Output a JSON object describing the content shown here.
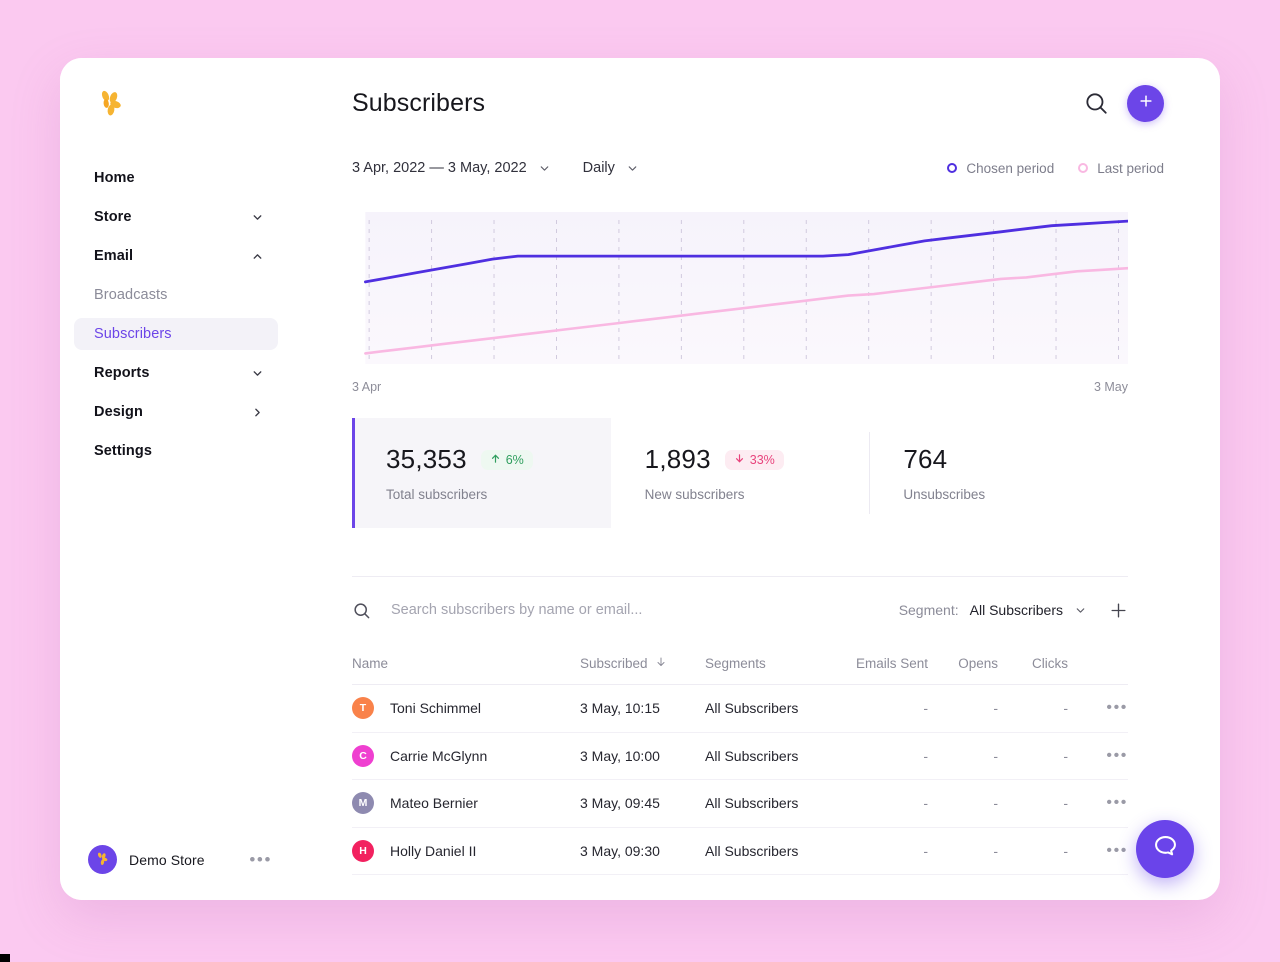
{
  "window": {
    "title": "Subscribers"
  },
  "brand": {
    "logo_icon": "butterfly-logo-icon",
    "accent": "#6c45e8",
    "logo_color": "#f6b432"
  },
  "sidebar": {
    "items": [
      {
        "label": "Home",
        "icon": "",
        "state": "default"
      },
      {
        "label": "Store",
        "icon": "chevron-down-icon",
        "state": "default"
      },
      {
        "label": "Email",
        "icon": "chevron-up-icon",
        "state": "default"
      },
      {
        "label": "Broadcasts",
        "icon": "",
        "state": "sub"
      },
      {
        "label": "Subscribers",
        "icon": "",
        "state": "active"
      },
      {
        "label": "Reports",
        "icon": "chevron-down-icon",
        "state": "default"
      },
      {
        "label": "Design",
        "icon": "chevron-right-icon",
        "state": "default"
      },
      {
        "label": "Settings",
        "icon": "",
        "state": "default"
      }
    ],
    "footer": {
      "store_name": "Demo Store",
      "avatar_icon": "butterfly-logo-icon",
      "menu_icon": "more-horizontal-icon"
    }
  },
  "topbar": {
    "title": "Subscribers",
    "search_icon": "search-icon",
    "add_icon": "plus-icon"
  },
  "filters": {
    "date_range": "3 Apr, 2022 — 3 May, 2022",
    "date_chevron": "chevron-down-icon",
    "granularity": "Daily",
    "granularity_chevron": "chevron-down-icon",
    "legend": [
      {
        "label": "Chosen period",
        "color": "#4f2fe0"
      },
      {
        "label": "Last period",
        "color": "#f9b8e2"
      }
    ]
  },
  "chart_data": {
    "type": "line",
    "title": "",
    "xlabel": "",
    "ylabel": "",
    "grid": "vertical-dashed",
    "legend_position": "top-right",
    "x_axis_start_label": "3 Apr",
    "x_axis_end_label": "3 May",
    "x": [
      0,
      1,
      2,
      3,
      4,
      5,
      6,
      7,
      8,
      9,
      10,
      11,
      12,
      13,
      14,
      15,
      16,
      17,
      18,
      19,
      20,
      21,
      22,
      23,
      24,
      25,
      26,
      27,
      28,
      29,
      30
    ],
    "ylim": [
      0,
      100
    ],
    "series": [
      {
        "name": "Chosen period",
        "color": "#4f2fe0",
        "values": [
          54,
          57,
          60,
          63,
          66,
          69,
          71,
          71,
          71,
          71,
          71,
          71,
          71,
          71,
          71,
          71,
          71,
          71,
          71,
          72,
          75,
          78,
          81,
          83,
          85,
          87,
          89,
          91,
          92,
          93,
          94
        ]
      },
      {
        "name": "Last period",
        "color": "#f9b8e2",
        "values": [
          7,
          9,
          11,
          13,
          15,
          17,
          19,
          21,
          23,
          25,
          27,
          29,
          31,
          33,
          35,
          37,
          39,
          41,
          43,
          45,
          46,
          48,
          50,
          52,
          54,
          56,
          57,
          59,
          61,
          62,
          63
        ]
      }
    ]
  },
  "stats": [
    {
      "value": "35,353",
      "label": "Total subscribers",
      "badge": "6%",
      "direction": "up",
      "arrow": "arrow-up-icon",
      "selected": true
    },
    {
      "value": "1,893",
      "label": "New subscribers",
      "badge": "33%",
      "direction": "down",
      "arrow": "arrow-down-icon",
      "selected": false
    },
    {
      "value": "764",
      "label": "Unsubscribes",
      "badge": "",
      "direction": "",
      "arrow": "",
      "selected": false
    }
  ],
  "list_controls": {
    "search_icon": "search-icon",
    "search_value": "",
    "search_placeholder": "Search subscribers by name or email...",
    "segment_prefix": "Segment:",
    "segment_value": "All Subscribers",
    "segment_chevron": "chevron-down-icon",
    "add_segment_icon": "plus-icon"
  },
  "table": {
    "columns": [
      {
        "key": "name",
        "label": "Name",
        "sort": ""
      },
      {
        "key": "sub",
        "label": "Subscribed",
        "sort": "arrow-down-icon"
      },
      {
        "key": "seg",
        "label": "Segments",
        "sort": ""
      },
      {
        "key": "sent",
        "label": "Emails Sent",
        "sort": ""
      },
      {
        "key": "opens",
        "label": "Opens",
        "sort": ""
      },
      {
        "key": "clicks",
        "label": "Clicks",
        "sort": ""
      }
    ],
    "rows": [
      {
        "initial": "T",
        "avatar_color": "#f9824a",
        "name": "Toni Schimmel",
        "subscribed": "3 May, 10:15",
        "segments": "All Subscribers",
        "emails_sent": "-",
        "opens": "-",
        "clicks": "-",
        "menu_icon": "more-horizontal-icon"
      },
      {
        "initial": "C",
        "avatar_color": "#ef3fd0",
        "name": "Carrie McGlynn",
        "subscribed": "3 May, 10:00",
        "segments": "All Subscribers",
        "emails_sent": "-",
        "opens": "-",
        "clicks": "-",
        "menu_icon": "more-horizontal-icon"
      },
      {
        "initial": "M",
        "avatar_color": "#8e8ab0",
        "name": "Mateo Bernier",
        "subscribed": "3 May, 09:45",
        "segments": "All Subscribers",
        "emails_sent": "-",
        "opens": "-",
        "clicks": "-",
        "menu_icon": "more-horizontal-icon"
      },
      {
        "initial": "H",
        "avatar_color": "#f2215f",
        "name": "Holly Daniel II",
        "subscribed": "3 May, 09:30",
        "segments": "All Subscribers",
        "emails_sent": "-",
        "opens": "-",
        "clicks": "-",
        "menu_icon": "more-horizontal-icon"
      }
    ]
  },
  "help": {
    "icon": "chat-bubble-icon",
    "color": "#6a44ea"
  }
}
